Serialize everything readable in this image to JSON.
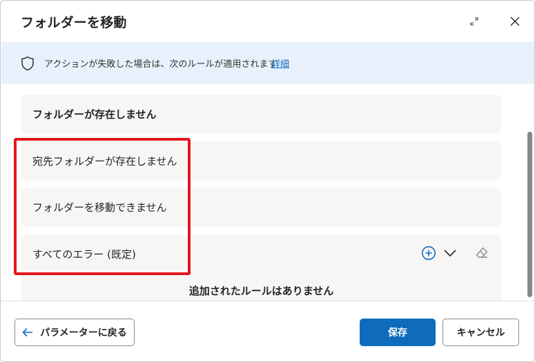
{
  "dialog": {
    "title": "フォルダーを移動"
  },
  "banner": {
    "text": "アクションが失敗した場合は、次のルールが適用されます",
    "link": "詳細"
  },
  "rules": {
    "group_header": "フォルダーが存在しません",
    "items": [
      "宛先フォルダーが存在しません",
      "フォルダーを移動できません",
      "すべてのエラー (既定)"
    ],
    "empty_message": "追加されたルールはありません"
  },
  "footer": {
    "back_label": "パラメーターに戻る",
    "save_label": "保存",
    "cancel_label": "キャンセル"
  },
  "colors": {
    "accent": "#0f6cbd",
    "banner_bg": "#e8f1fb",
    "card_bg": "#f7f6f5",
    "highlight": "#e3161c"
  },
  "icons": [
    "expand-icon",
    "close-icon",
    "shield-icon",
    "add-circle-icon",
    "chevron-down-icon",
    "eraser-icon",
    "arrow-left-icon"
  ]
}
